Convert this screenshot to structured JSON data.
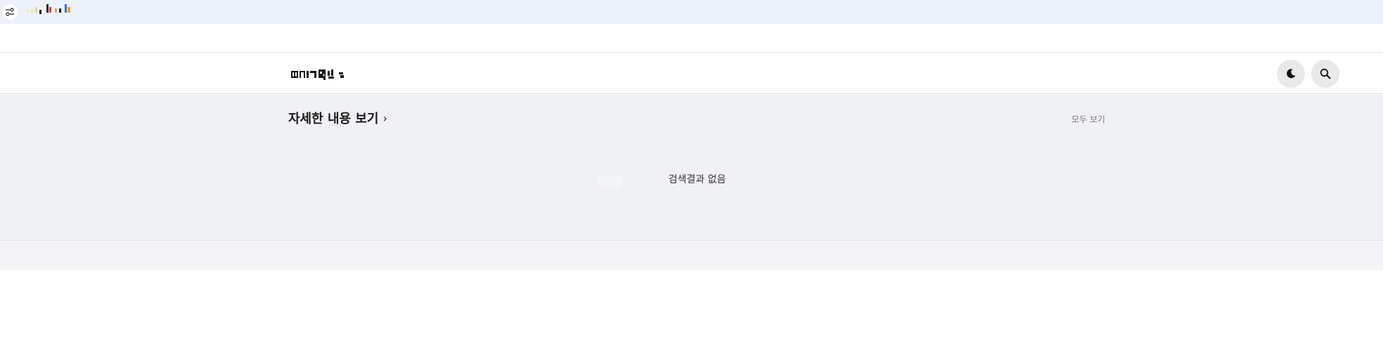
{
  "topbar": {
    "tune_icon": "tune-icon",
    "logo_text": ""
  },
  "header": {
    "logo_text": "",
    "theme_toggle_icon": "moon-icon",
    "search_icon": "search-icon"
  },
  "main": {
    "section_title": "자세한 내용 보기",
    "view_all_label": "모두 보기",
    "empty_message": "검색결과 없음"
  },
  "colors": {
    "topstrip_bg": "#ecf1fa",
    "main_bg": "#f0f1f5",
    "button_bg": "#e9e9ec"
  }
}
